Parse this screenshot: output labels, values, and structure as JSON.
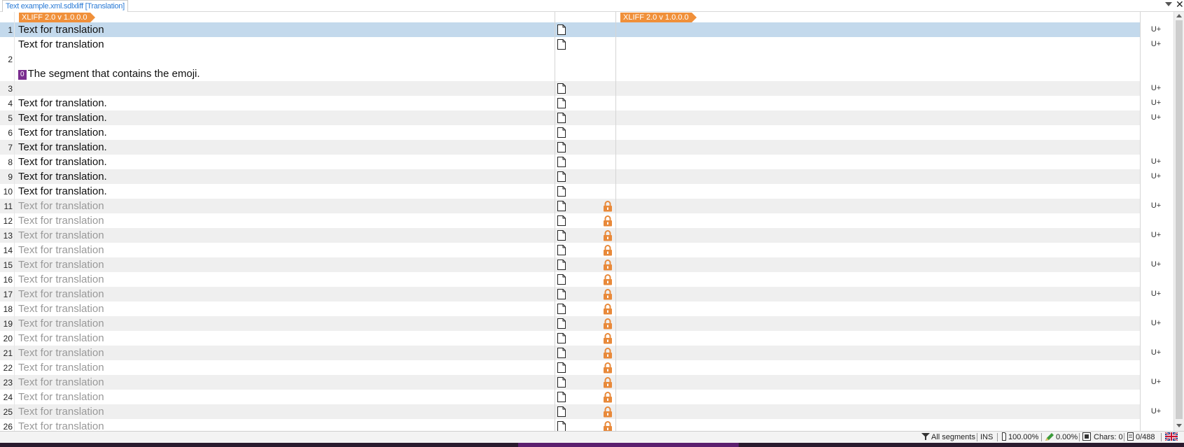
{
  "tab": {
    "title": "Text example.xml.sdlxliff [Translation]"
  },
  "header": {
    "source_file_tag": "XLIFF 2.0 v 1.0.0.0",
    "target_file_tag": "XLIFF 2.0 v 1.0.0.0"
  },
  "colors": {
    "file_tag": "#f0903a",
    "active_row": "#c3d9ec",
    "alt_row": "#efefef",
    "tag_badge": "#7a2d8f",
    "lock": "#e8893a",
    "link_text": "#2b7bd6"
  },
  "segments": [
    {
      "num": "1",
      "source": "Text for translation",
      "locked": false,
      "uplus": "U+"
    },
    {
      "num": "2",
      "lines": [
        {
          "text": "Text for translation",
          "uplus": "U+"
        },
        {
          "text": ""
        },
        {
          "tag": "0",
          "text": "The segment that contains the emoji."
        }
      ]
    },
    {
      "num": "3",
      "source": "",
      "locked": false,
      "uplus": "U+"
    },
    {
      "num": "4",
      "source": "Text for translation.",
      "locked": false,
      "uplus": "U+"
    },
    {
      "num": "5",
      "source": "Text for translation.",
      "locked": false,
      "uplus": "U+"
    },
    {
      "num": "6",
      "source": "Text for translation.",
      "locked": false,
      "uplus": ""
    },
    {
      "num": "7",
      "source": "Text for translation.",
      "locked": false,
      "uplus": ""
    },
    {
      "num": "8",
      "source": "Text for translation.",
      "locked": false,
      "uplus": "U+"
    },
    {
      "num": "9",
      "source": "Text for translation.",
      "locked": false,
      "uplus": "U+"
    },
    {
      "num": "10",
      "source": "Text for translation.",
      "locked": false,
      "uplus": ""
    },
    {
      "num": "11",
      "source": "Text for translation",
      "locked": true,
      "uplus": "U+"
    },
    {
      "num": "12",
      "source": "Text for translation",
      "locked": true,
      "uplus": ""
    },
    {
      "num": "13",
      "source": "Text for translation",
      "locked": true,
      "uplus": "U+"
    },
    {
      "num": "14",
      "source": "Text for translation",
      "locked": true,
      "uplus": ""
    },
    {
      "num": "15",
      "source": "Text for translation",
      "locked": true,
      "uplus": "U+"
    },
    {
      "num": "16",
      "source": "Text for translation",
      "locked": true,
      "uplus": ""
    },
    {
      "num": "17",
      "source": "Text for translation",
      "locked": true,
      "uplus": "U+"
    },
    {
      "num": "18",
      "source": "Text for translation",
      "locked": true,
      "uplus": ""
    },
    {
      "num": "19",
      "source": "Text for translation",
      "locked": true,
      "uplus": "U+"
    },
    {
      "num": "20",
      "source": "Text for translation",
      "locked": true,
      "uplus": ""
    },
    {
      "num": "21",
      "source": "Text for translation",
      "locked": true,
      "uplus": "U+"
    },
    {
      "num": "22",
      "source": "Text for translation",
      "locked": true,
      "uplus": ""
    },
    {
      "num": "23",
      "source": "Text for translation",
      "locked": true,
      "uplus": "U+"
    },
    {
      "num": "24",
      "source": "Text for translation",
      "locked": true,
      "uplus": ""
    },
    {
      "num": "25",
      "source": "Text for translation",
      "locked": true,
      "uplus": "U+"
    },
    {
      "num": "26",
      "source": "Text for translation",
      "locked": true,
      "uplus": ""
    }
  ],
  "statusbar": {
    "filter": "All segments",
    "mode": "INS",
    "percent_1": "100.00%",
    "percent_2": "0.00%",
    "chars": "Chars: 0",
    "count": "0/488"
  }
}
